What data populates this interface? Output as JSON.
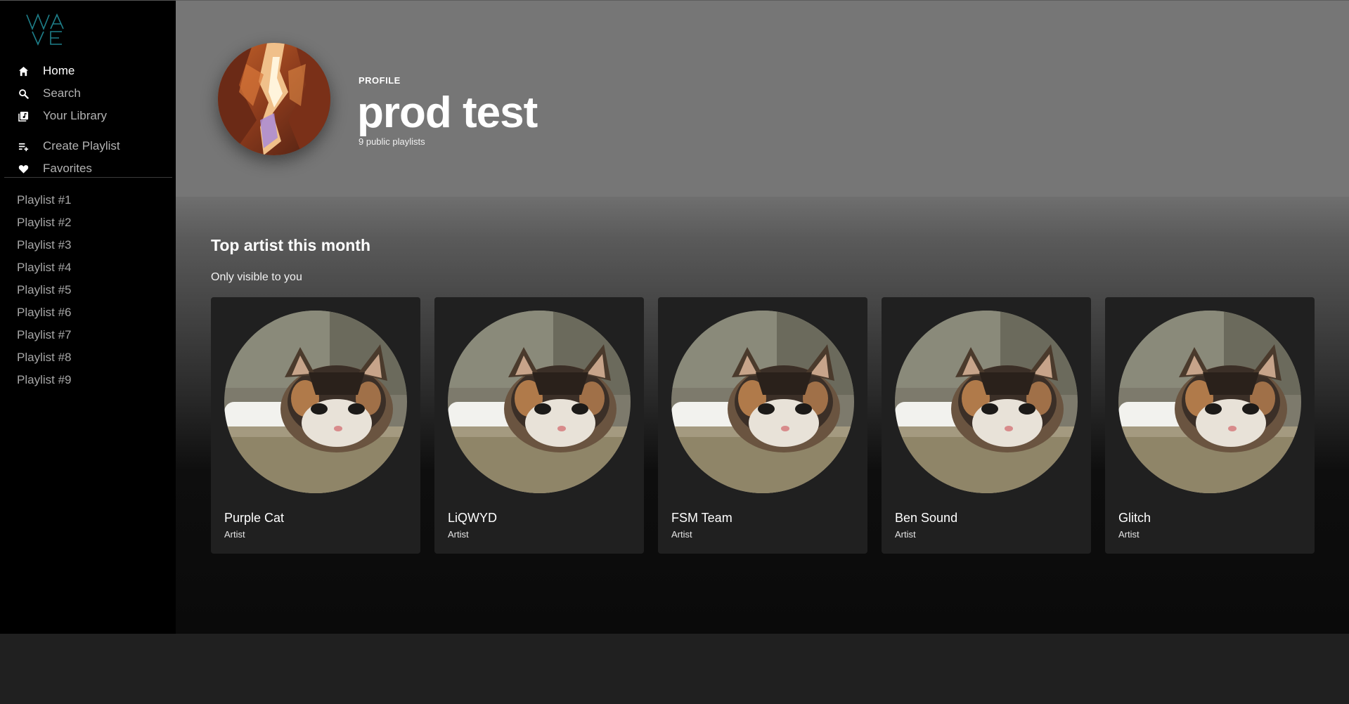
{
  "brand": {
    "logo_text": "WAVE",
    "accent": "#1e7f8a"
  },
  "nav": {
    "primary": [
      {
        "label": "Home",
        "icon": "home-icon",
        "active": true
      },
      {
        "label": "Search",
        "icon": "search-icon",
        "active": false
      },
      {
        "label": "Your Library",
        "icon": "library-icon",
        "active": false
      }
    ],
    "secondary": [
      {
        "label": "Create Playlist",
        "icon": "add-playlist-icon"
      },
      {
        "label": "Favorites",
        "icon": "heart-icon"
      }
    ]
  },
  "playlists": [
    "Playlist #1",
    "Playlist #2",
    "Playlist #3",
    "Playlist #4",
    "Playlist #5",
    "Playlist #6",
    "Playlist #7",
    "Playlist #8",
    "Playlist #9"
  ],
  "profile": {
    "label": "PROFILE",
    "name": "prod test",
    "meta": "9 public playlists"
  },
  "section": {
    "title": "Top artist this month",
    "subtitle": "Only visible to you"
  },
  "artists": [
    {
      "name": "Purple Cat",
      "role": "Artist"
    },
    {
      "name": "LiQWYD",
      "role": "Artist"
    },
    {
      "name": "FSM Team",
      "role": "Artist"
    },
    {
      "name": "Ben Sound",
      "role": "Artist"
    },
    {
      "name": "Glitch",
      "role": "Artist"
    }
  ]
}
